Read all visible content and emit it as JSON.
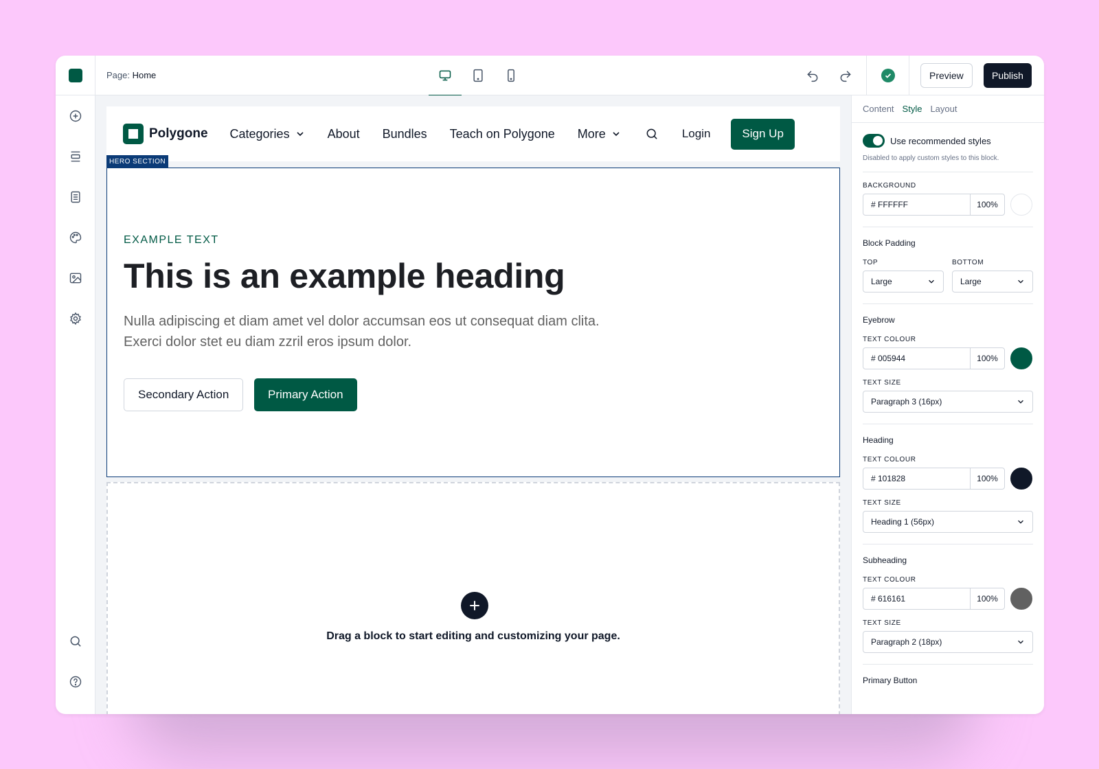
{
  "topbar": {
    "page_prefix": "Page:",
    "page_name": "Home",
    "devices": [
      "desktop-icon",
      "tablet-icon",
      "mobile-icon"
    ],
    "preview_label": "Preview",
    "publish_label": "Publish"
  },
  "rail": {
    "top_icons": [
      "add-icon",
      "sections-icon",
      "pages-icon",
      "palette-icon",
      "image-icon",
      "settings-icon"
    ],
    "bottom_icons": [
      "search-icon",
      "help-icon"
    ]
  },
  "site": {
    "brand": "Polygone",
    "nav": [
      "Categories",
      "About",
      "Bundles",
      "Teach on Polygone",
      "More"
    ],
    "login": "Login",
    "signup": "Sign Up",
    "section_tag": "HERO SECTION",
    "eyebrow": "EXAMPLE TEXT",
    "heading": "This is an example heading",
    "subheading": "Nulla adipiscing et diam amet vel dolor accumsan eos ut consequat diam clita. Exerci dolor stet eu diam zzril eros ipsum dolor.",
    "secondary_action": "Secondary Action",
    "primary_action": "Primary Action",
    "drop_text": "Drag a block to start editing and customizing your page."
  },
  "panel": {
    "tabs": [
      "Content",
      "Style",
      "Layout"
    ],
    "active_tab": "Style",
    "toggle_label": "Use recommended styles",
    "toggle_hint": "Disabled to apply custom styles to this block.",
    "background": {
      "label": "BACKGROUND",
      "hex": "# FFFFFF",
      "opacity": "100%",
      "color": "#FFFFFF"
    },
    "padding": {
      "title": "Block Padding",
      "top_label": "TOP",
      "top_value": "Large",
      "bottom_label": "BOTTOM",
      "bottom_value": "Large"
    },
    "eyebrow": {
      "title": "Eyebrow",
      "color_label": "TEXT COLOUR",
      "hex": "# 005944",
      "opacity": "100%",
      "color": "#005944",
      "size_label": "TEXT SIZE",
      "size": "Paragraph 3 (16px)"
    },
    "heading": {
      "title": "Heading",
      "color_label": "TEXT COLOUR",
      "hex": "# 101828",
      "opacity": "100%",
      "color": "#101828",
      "size_label": "TEXT SIZE",
      "size": "Heading 1 (56px)"
    },
    "subheading": {
      "title": "Subheading",
      "color_label": "TEXT COLOUR",
      "hex": "# 616161",
      "opacity": "100%",
      "color": "#616161",
      "size_label": "TEXT SIZE",
      "size": "Paragraph 2 (18px)"
    },
    "primary_button_title": "Primary Button"
  },
  "colors": {
    "brand": "#005944",
    "dark": "#101828",
    "background": "#fcc8fb",
    "section_outline": "#0b3b77"
  }
}
